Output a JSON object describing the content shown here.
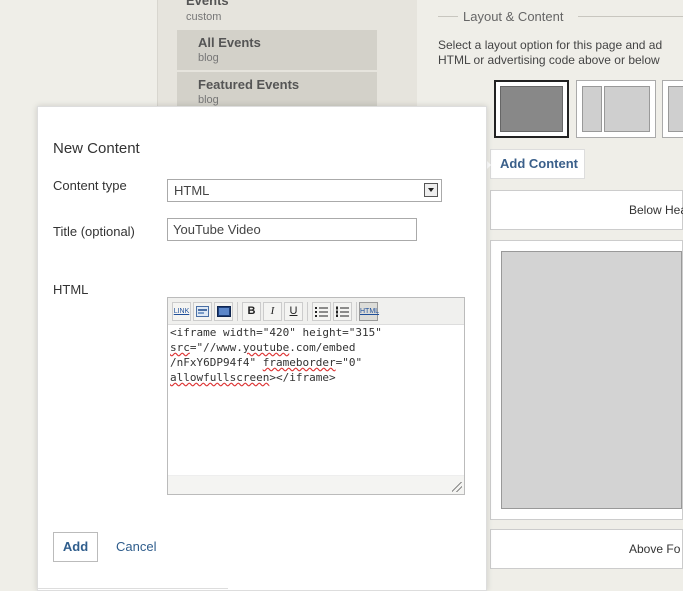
{
  "nav": {
    "parent": {
      "title": "Events",
      "subtitle": "custom"
    },
    "items": [
      {
        "title": "All Events",
        "subtitle": "blog"
      },
      {
        "title": "Featured Events",
        "subtitle": "blog"
      }
    ]
  },
  "layout_panel": {
    "legend": "Layout & Content",
    "description_line1": "Select a layout option for this page and ad",
    "description_line2": "HTML or advertising code above or below",
    "add_content_tab": "Add Content",
    "below_header": "Below Hea",
    "above_footer": "Above Fo"
  },
  "dialog": {
    "title": "New Content",
    "content_type_label": "Content type",
    "content_type_value": "HTML",
    "title_label": "Title (optional)",
    "title_value": "YouTube Video",
    "html_label": "HTML",
    "toolbar": {
      "link": "LINK",
      "bold": "B",
      "italic": "I",
      "underline": "U",
      "html": "HTML"
    },
    "code": {
      "l1": "<iframe width=\"420\" height=\"315\"",
      "l2a": "src",
      "l2b": "=\"//www.",
      "l2c": "youtube",
      "l2d": ".com/embed",
      "l3a": "/nFxY6DP94f4\" ",
      "l3b": "frameborder",
      "l3c": "=\"0\"",
      "l4a": "allowfullscreen",
      "l4b": "></iframe>"
    },
    "add_button": "Add",
    "cancel_link": "Cancel"
  },
  "colors": {
    "link_blue": "#2f5d8c",
    "page_bg": "#efeee8",
    "nav_item_bg": "#d3d1c9"
  }
}
